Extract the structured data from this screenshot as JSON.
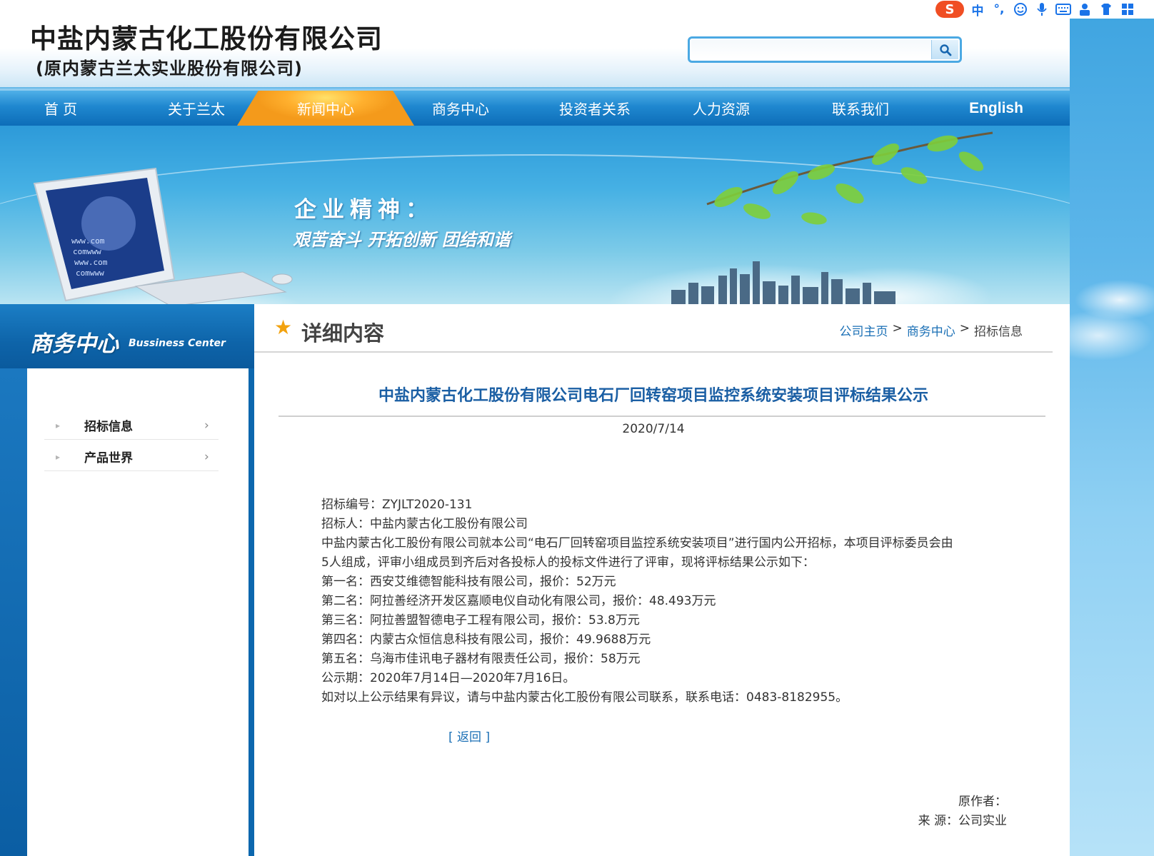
{
  "ime": {
    "logo": "S",
    "mode_label": "中",
    "punct_label": "°,",
    "icons": [
      "emoji-icon",
      "mic-icon",
      "keyboard-icon",
      "user-icon",
      "shirt-icon",
      "grid-icon"
    ]
  },
  "header": {
    "company_name": "中盐内蒙古化工股份有限公司",
    "company_former": "(原内蒙古兰太实业股份有限公司)",
    "search": {
      "placeholder": ""
    }
  },
  "nav": {
    "items": [
      {
        "label": "首  页"
      },
      {
        "label": "关于兰太"
      },
      {
        "label": "新闻中心",
        "active": true
      },
      {
        "label": "商务中心"
      },
      {
        "label": "投资者关系"
      },
      {
        "label": "人力资源"
      },
      {
        "label": "联系我们"
      },
      {
        "label": "English"
      }
    ]
  },
  "banner": {
    "title": "企业精神：",
    "slogan": "艰苦奋斗 开拓创新 团结和谐"
  },
  "sidebar": {
    "title": "商务中心",
    "title_en": "Bussiness Center",
    "items": [
      {
        "label": "招标信息"
      },
      {
        "label": "产品世界"
      }
    ]
  },
  "main": {
    "heading": "详细内容",
    "breadcrumb": {
      "home": "公司主页",
      "section": "商务中心",
      "current": "招标信息",
      "sep": ">"
    }
  },
  "article": {
    "title": "中盐内蒙古化工股份有限公司电石厂回转窑项目监控系统安装项目评标结果公示",
    "date": "2020/7/14",
    "lines": [
      "招标编号：ZYJLT2020-131",
      "招标人：中盐内蒙古化工股份有限公司",
      "中盐内蒙古化工股份有限公司就本公司“电石厂回转窑项目监控系统安装项目”进行国内公开招标，本项目评标委员会由",
      "5人组成，评审小组成员到齐后对各投标人的投标文件进行了评审，现将评标结果公示如下：",
      "第一名：西安艾维德智能科技有限公司，报价：52万元",
      "第二名：阿拉善经济开发区嘉顺电仪自动化有限公司，报价：48.493万元",
      "第三名：阿拉善盟智德电子工程有限公司，报价：53.8万元",
      "第四名：内蒙古众恒信息科技有限公司，报价：49.9688万元",
      "第五名：乌海市佳讯电子器材有限责任公司，报价：58万元",
      "公示期：2020年7月14日—2020年7月16日。",
      "如对以上公示结果有异议，请与中盐内蒙古化工股份有限公司联系，联系电话：0483-8182955。"
    ],
    "back_label": "[ 返回 ]",
    "author_label": "原作者：",
    "source_label": "来 源：公司实业"
  },
  "colors": {
    "nav_blue": "#1f87cf",
    "active_orange": "#f49a1b",
    "title_blue": "#1b5fa4",
    "link_blue": "#1a6fb5",
    "sidebar_blue": "#0c67ae"
  }
}
